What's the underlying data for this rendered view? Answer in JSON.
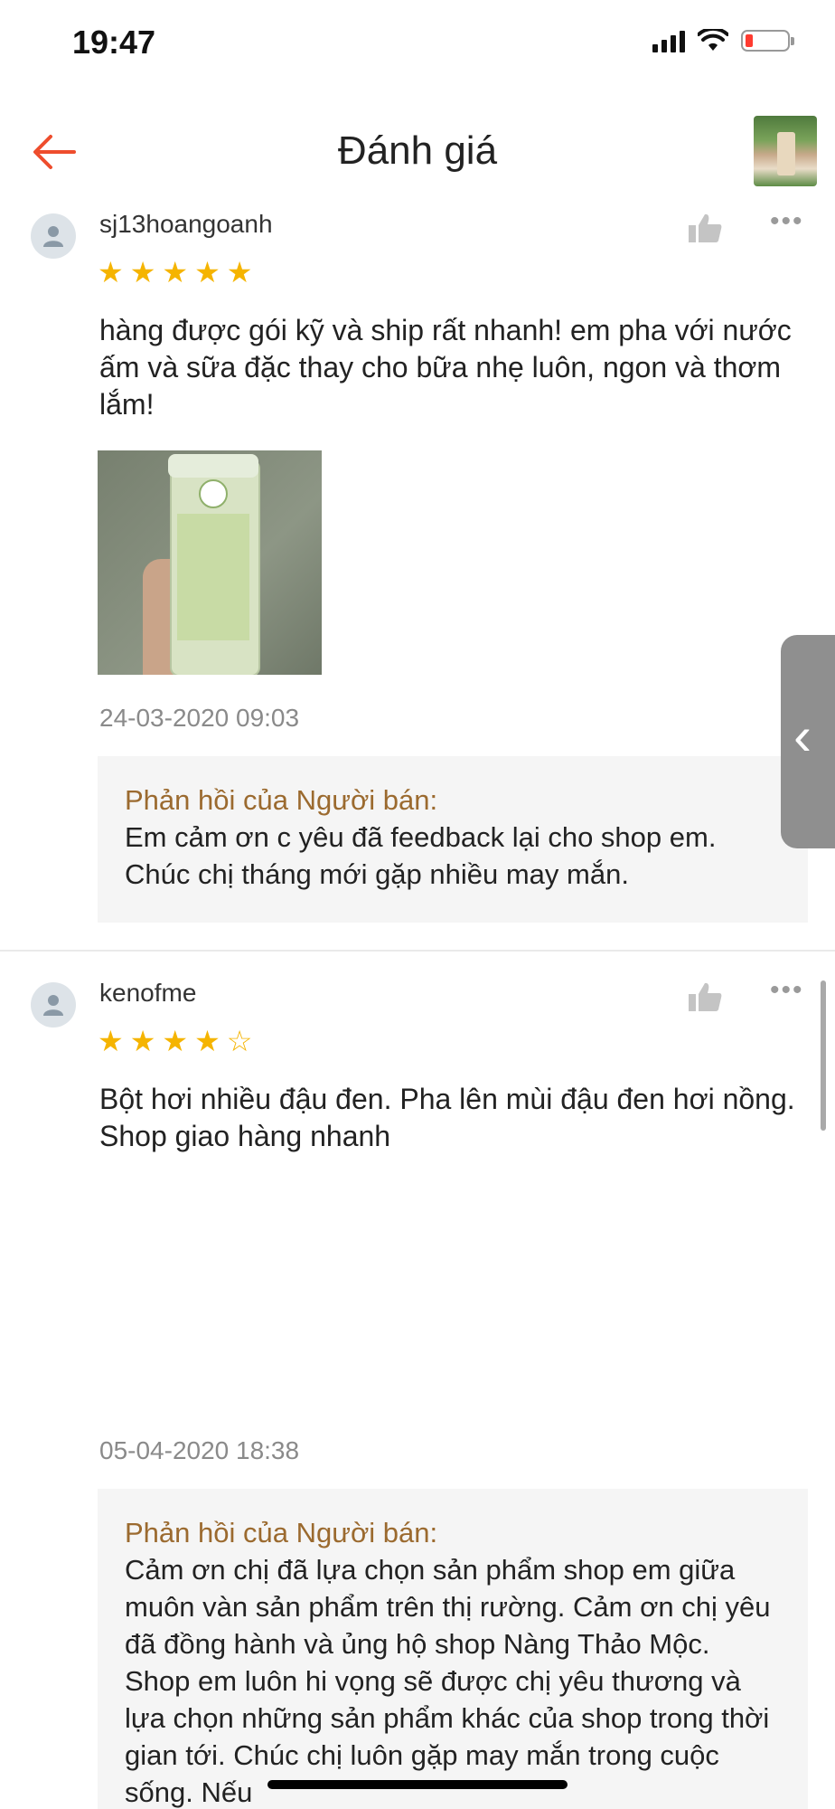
{
  "status_bar": {
    "time": "19:47"
  },
  "header": {
    "title": "Đánh giá"
  },
  "reviews": [
    {
      "username": "sj13hoangoanh",
      "rating": 5,
      "text": "hàng được gói kỹ và ship rất nhanh! em pha với nước ấm và sữa đặc thay cho bữa nhẹ luôn, ngon và thơm lắm!",
      "date": "24-03-2020 09:03",
      "reply_title": "Phản hồi của Người bán:",
      "reply_text": "Em cảm ơn c yêu đã feedback lại cho shop em. Chúc chị tháng mới gặp nhiều may mắn."
    },
    {
      "username": "kenofme",
      "rating": 4,
      "text": "Bột hơi nhiều đậu đen. Pha lên mùi đậu đen hơi nồng. Shop giao hàng nhanh",
      "date": "05-04-2020 18:38",
      "reply_title": "Phản hồi của Người bán:",
      "reply_text": "Cảm ơn chị đã lựa chọn sản phẩm shop em giữa muôn vàn sản phẩm trên thị rường. Cảm ơn chị yêu đã đồng hành và ủng hộ shop Nàng Thảo Mộc. Shop em luôn hi vọng sẽ được chị yêu thương và lựa chọn những sản phẩm khác của shop trong thời gian tới. Chúc chị luôn gặp may mắn trong cuộc sống. Nếu"
    }
  ],
  "icons": {
    "back": "arrow-left-icon",
    "like": "thumbs-up-icon",
    "more": "more-horizontal-icon",
    "side": "chevron-left-icon"
  },
  "colors": {
    "accent": "#ee4d2d",
    "star": "#f5b400",
    "reply_title": "#9b6a2f"
  }
}
